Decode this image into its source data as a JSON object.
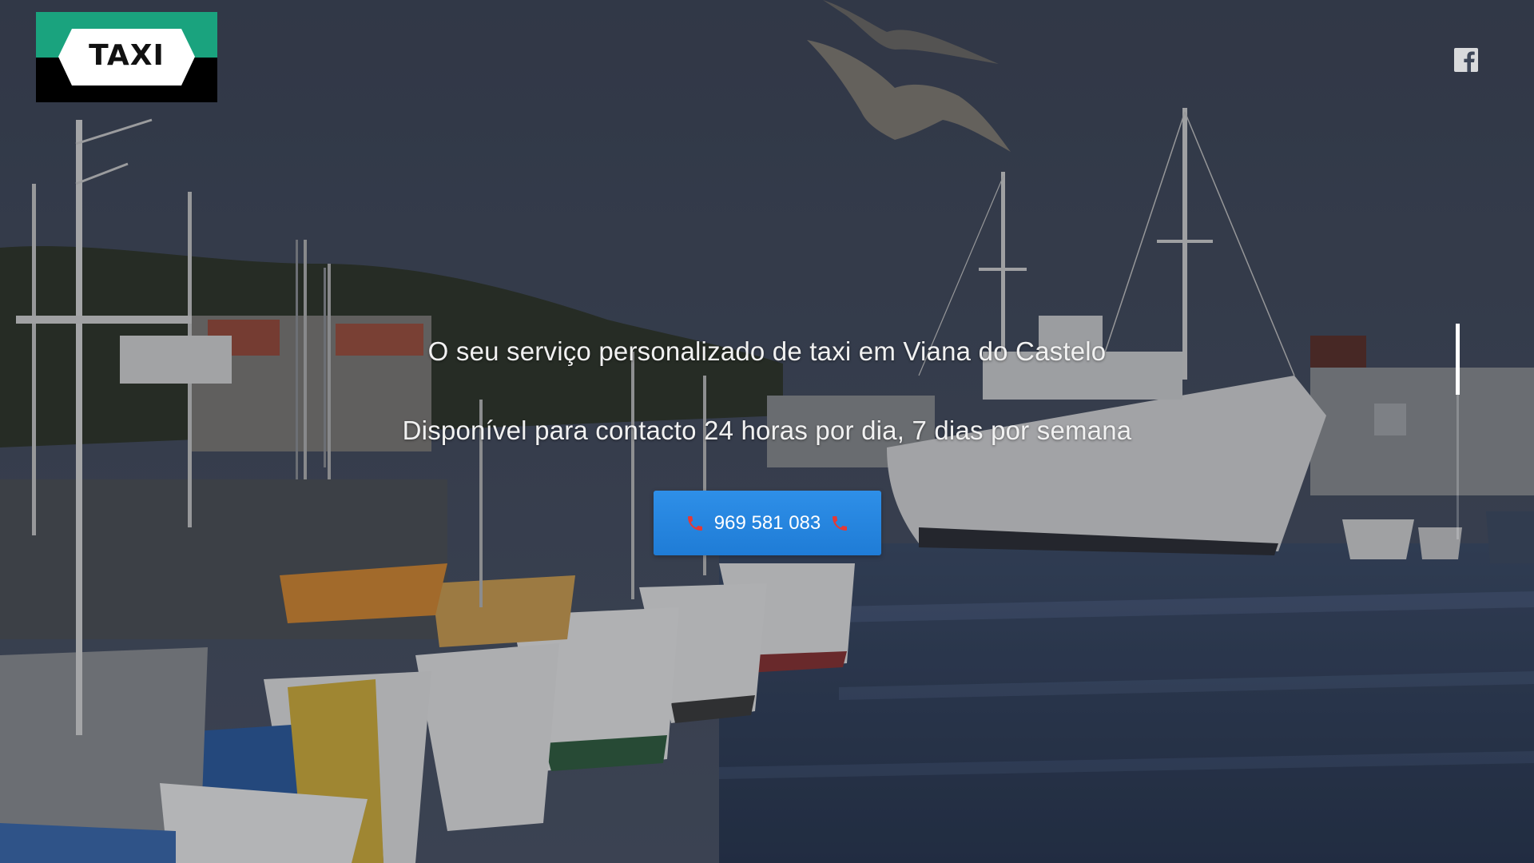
{
  "brand": {
    "logo_text": "TAXI",
    "logo_top_color": "#1aa37e",
    "logo_bottom_color": "#000000"
  },
  "header": {
    "social_icon": "facebook-icon"
  },
  "hero": {
    "tagline": "O seu serviço personalizado de taxi em Viana do Castelo",
    "availability": "Disponível para contacto 24 horas por dia, 7 dias por semana",
    "background_scene": "harbor-with-fishing-boats-and-ship"
  },
  "call_button": {
    "phone_number": "969 581 083",
    "icon": "phone-icon",
    "color": "#2e8fe8",
    "icon_color": "#e53935"
  },
  "scroll": {
    "progress": 0.33
  }
}
